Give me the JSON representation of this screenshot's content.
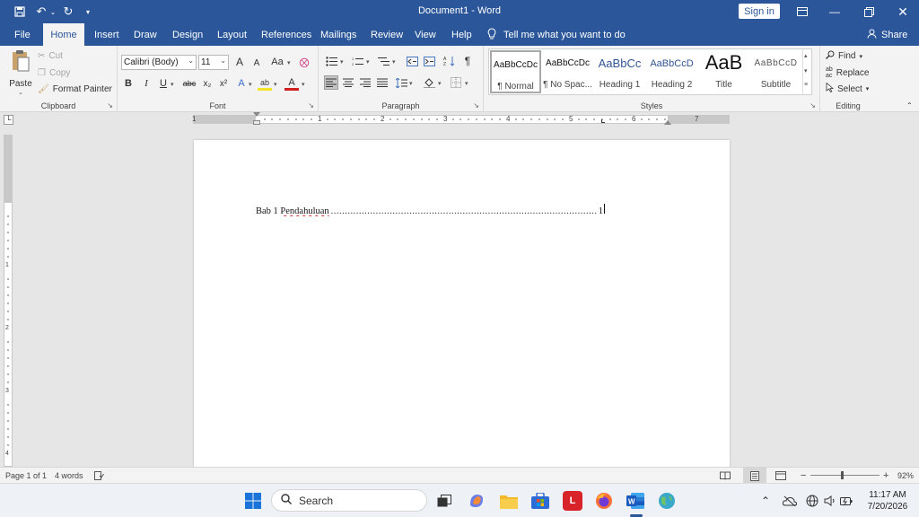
{
  "titlebar": {
    "doc_title": "Document1  -  Word",
    "sign_in": "Sign in",
    "icons": [
      "save-icon",
      "undo-icon",
      "redo-icon",
      "customize-qat-icon",
      "ribbon-display-icon",
      "minimize-icon",
      "restore-icon",
      "close-icon"
    ]
  },
  "tabs": [
    {
      "label": "File"
    },
    {
      "label": "Home"
    },
    {
      "label": "Insert"
    },
    {
      "label": "Draw"
    },
    {
      "label": "Design"
    },
    {
      "label": "Layout"
    },
    {
      "label": "References"
    },
    {
      "label": "Mailings"
    },
    {
      "label": "Review"
    },
    {
      "label": "View"
    },
    {
      "label": "Help"
    }
  ],
  "tellme": "Tell me what you want to do",
  "share": "Share",
  "ribbon": {
    "clipboard": {
      "paste": "Paste",
      "cut": "Cut",
      "copy": "Copy",
      "format_painter": "Format Painter",
      "label": "Clipboard"
    },
    "font": {
      "name": "Calibri (Body)",
      "size": "11",
      "grow": "A",
      "shrink": "A",
      "change_case": "Aa",
      "bold": "B",
      "italic": "I",
      "underline": "U",
      "strike": "abc",
      "subscript": "x₂",
      "superscript": "x²",
      "effects": "A",
      "highlight": "ab",
      "color": "A",
      "label": "Font"
    },
    "paragraph": {
      "label": "Paragraph",
      "pilcrow": "¶"
    },
    "styles": {
      "label": "Styles",
      "items": [
        {
          "preview": "AaBbCcDc",
          "name": "¶ Normal"
        },
        {
          "preview": "AaBbCcDc",
          "name": "¶ No Spac..."
        },
        {
          "preview": "AaBbCc",
          "name": "Heading 1"
        },
        {
          "preview": "AaBbCcD",
          "name": "Heading 2"
        },
        {
          "preview": "AaB",
          "name": "Title"
        },
        {
          "preview": "AaBbCcD",
          "name": "Subtitle"
        }
      ]
    },
    "editing": {
      "find": "Find",
      "replace": "Replace",
      "select": "Select",
      "label": "Editing"
    }
  },
  "document": {
    "toc_prefix": "Bab 1 ",
    "toc_word": "Pendahuluan",
    "toc_dots": "..........................................................................................................................................................................",
    "toc_page": "1"
  },
  "statusbar": {
    "page": "Page 1 of 1",
    "words": "4 words",
    "zoom": "92%",
    "zoom_minus": "−",
    "zoom_plus": "+"
  },
  "taskbar": {
    "search": "Search",
    "time": "11:17 AM",
    "date": "7/20/2026"
  }
}
